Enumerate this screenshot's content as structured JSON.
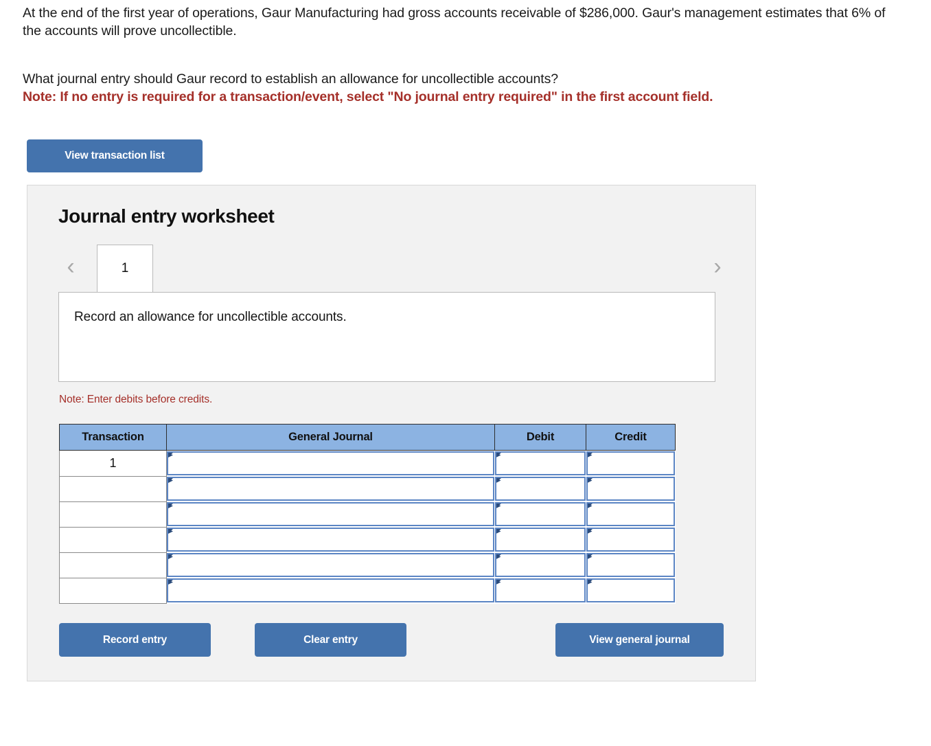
{
  "question": {
    "paragraph1": "At the end of the first year of operations, Gaur Manufacturing had gross accounts receivable of $286,000. Gaur's management estimates that 6% of the accounts will prove uncollectible.",
    "paragraph2": "What journal entry should Gaur record to establish an allowance for uncollectible accounts?",
    "note": "Note: If no entry is required for a transaction/event, select \"No journal entry required\" in the first account field."
  },
  "toolbar": {
    "view_transaction_list_label": "View transaction list"
  },
  "worksheet": {
    "title": "Journal entry worksheet",
    "prev_icon": "chevron-left-icon",
    "next_icon": "chevron-right-icon",
    "tabs": [
      {
        "label": "1",
        "active": true
      }
    ],
    "description": "Record an allowance for uncollectible accounts.",
    "note": "Note: Enter debits before credits.",
    "table": {
      "headers": [
        "Transaction",
        "General Journal",
        "Debit",
        "Credit"
      ],
      "rows": [
        {
          "transaction": "1",
          "general_journal": "",
          "debit": "",
          "credit": ""
        },
        {
          "transaction": "",
          "general_journal": "",
          "debit": "",
          "credit": ""
        },
        {
          "transaction": "",
          "general_journal": "",
          "debit": "",
          "credit": ""
        },
        {
          "transaction": "",
          "general_journal": "",
          "debit": "",
          "credit": ""
        },
        {
          "transaction": "",
          "general_journal": "",
          "debit": "",
          "credit": ""
        },
        {
          "transaction": "",
          "general_journal": "",
          "debit": "",
          "credit": ""
        }
      ]
    },
    "footer": {
      "record_entry_label": "Record entry",
      "clear_entry_label": "Clear entry",
      "view_general_journal_label": "View general journal"
    }
  },
  "colors": {
    "button_blue": "#4473ad",
    "header_blue": "#8cb3e2",
    "note_red": "#a5302a",
    "panel_gray": "#f2f2f2",
    "cell_border_blue": "#5b85c4"
  }
}
